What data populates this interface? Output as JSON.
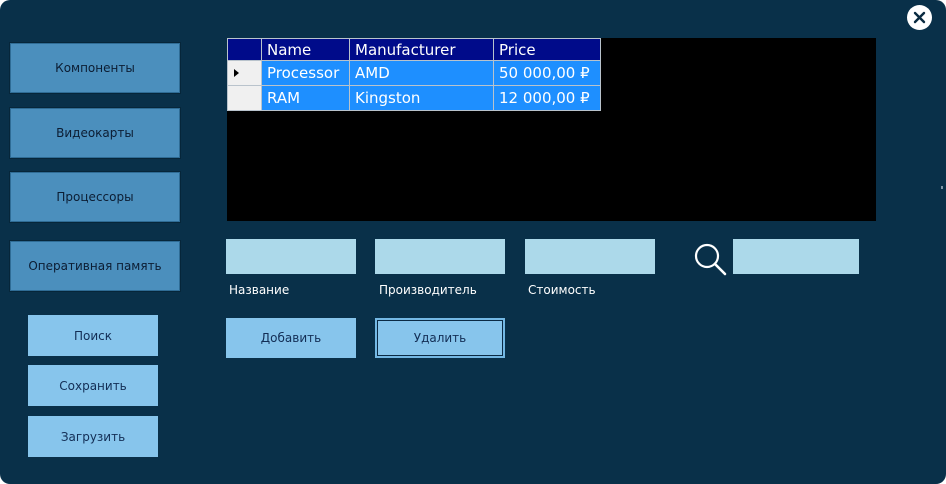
{
  "colors": {
    "window_bg": "#093049",
    "nav_button": "#4b8fbd",
    "action_button": "#87c5ec",
    "input_bg": "#acd9ea",
    "grid_header": "#000b8a",
    "grid_row": "#1e8fff",
    "grid_bg": "#000000"
  },
  "window": {
    "close_icon": "close-x-icon"
  },
  "sidebar": {
    "nav_buttons": [
      {
        "label": "Компоненты"
      },
      {
        "label": "Видеокарты"
      },
      {
        "label": "Процессоры"
      },
      {
        "label": "Оперативная память"
      }
    ],
    "actions": [
      {
        "label": "Поиск"
      },
      {
        "label": "Сохранить"
      },
      {
        "label": "Загрузить"
      }
    ]
  },
  "grid": {
    "columns": [
      "Name",
      "Manufacturer",
      "Price"
    ],
    "rows": [
      {
        "name": "Processor",
        "manufacturer": "AMD",
        "price": "50 000,00 ₽",
        "current": true
      },
      {
        "name": "RAM",
        "manufacturer": "Kingston",
        "price": "12 000,00 ₽",
        "current": false
      }
    ]
  },
  "form": {
    "fields": [
      {
        "label": "Название",
        "value": ""
      },
      {
        "label": "Производитель",
        "value": ""
      },
      {
        "label": "Стоимость",
        "value": ""
      }
    ],
    "search": {
      "icon": "magnifier-icon",
      "value": ""
    },
    "add_label": "Добавить",
    "delete_label": "Удалить"
  }
}
